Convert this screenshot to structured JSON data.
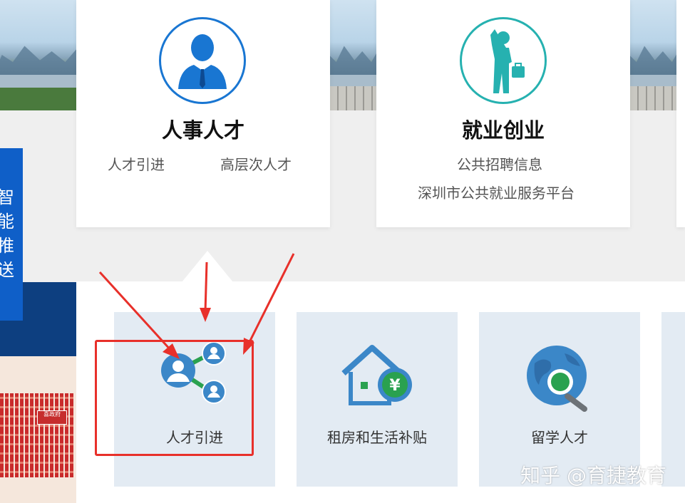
{
  "sidebar": {
    "vertical_text": "智能推送"
  },
  "qr_panel": {
    "badge_text": "喜政府"
  },
  "cards": [
    {
      "title": "人事人才",
      "icon": "businessman-icon",
      "links": [
        "人才引进",
        "高层次人才"
      ]
    },
    {
      "title": "就业创业",
      "icon": "job-seeker-icon",
      "links": [
        "公共招聘信息",
        "深圳市公共就业服务平台"
      ]
    }
  ],
  "tiles": [
    {
      "label": "人才引进",
      "icon": "talent-network-icon",
      "highlighted": true
    },
    {
      "label": "租房和生活补贴",
      "icon": "house-subsidy-icon"
    },
    {
      "label": "留学人才",
      "icon": "globe-search-icon"
    }
  ],
  "watermark": "知乎 @育捷教育",
  "colors": {
    "brand_blue": "#1976d2",
    "teal": "#26b1b0",
    "annotation_red": "#e8302a",
    "tile_bg": "#e3ebf3"
  }
}
